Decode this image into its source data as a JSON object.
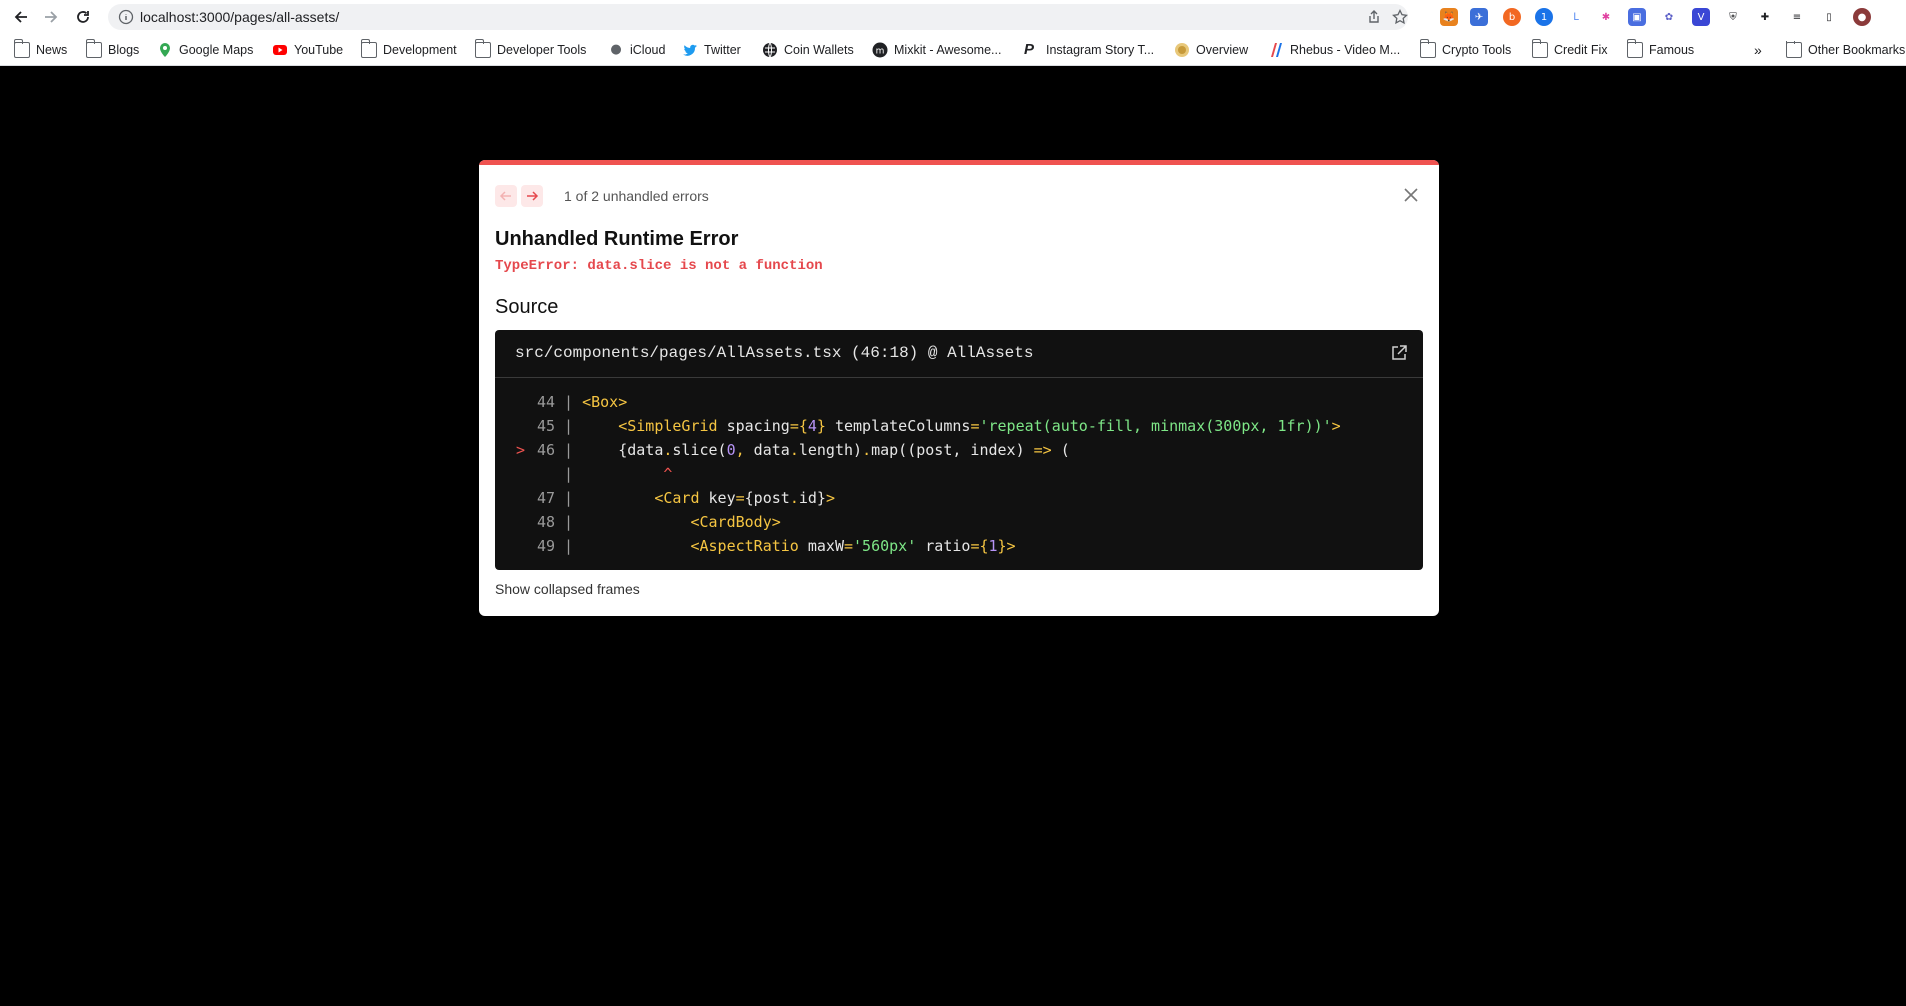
{
  "browser": {
    "url": "localhost:3000/pages/all-assets/",
    "bookmarks": [
      "News",
      "Blogs",
      "Google Maps",
      "YouTube",
      "Development",
      "Developer Tools",
      "iCloud",
      "Twitter",
      "Coin Wallets",
      "Mixkit - Awesome...",
      "Instagram Story T...",
      "Overview",
      "Rhebus - Video M...",
      "Crypto Tools",
      "Credit Fix",
      "Famous"
    ],
    "more_bookmarks": "»",
    "other_bookmarks": "Other Bookmarks"
  },
  "dialog": {
    "pager_text": "1 of 2 unhandled errors",
    "title": "Unhandled Runtime Error",
    "message": "TypeError: data.slice is not a function",
    "source_heading": "Source",
    "file_ref": "src/components/pages/AllAssets.tsx (46:18) @ AllAssets",
    "collapsed_link": "Show collapsed frames",
    "code_lines": [
      {
        "marker": " ",
        "num": "44",
        "tokens": [
          [
            "tag",
            "<Box>"
          ]
        ]
      },
      {
        "marker": " ",
        "num": "45",
        "tokens": [
          [
            "plain",
            "    "
          ],
          [
            "tag",
            "<SimpleGrid"
          ],
          [
            "attr",
            " spacing"
          ],
          [
            "tag",
            "={"
          ],
          [
            "numv",
            "4"
          ],
          [
            "tag",
            "}"
          ],
          [
            "attr",
            " templateColumns"
          ],
          [
            "tag",
            "="
          ],
          [
            "str",
            "'repeat(auto-fill, minmax(300px, 1fr))'"
          ],
          [
            "tag",
            ">"
          ]
        ]
      },
      {
        "marker": ">",
        "num": "46",
        "tokens": [
          [
            "plain",
            "    {data"
          ],
          [
            "tag",
            "."
          ],
          [
            "plain",
            "slice("
          ],
          [
            "numv",
            "0"
          ],
          [
            "tag",
            ","
          ],
          [
            "plain",
            " data"
          ],
          [
            "tag",
            "."
          ],
          [
            "plain",
            "length)"
          ],
          [
            "tag",
            "."
          ],
          [
            "plain",
            "map((post, index) "
          ],
          [
            "tag",
            "=>"
          ],
          [
            "plain",
            " ("
          ]
        ]
      },
      {
        "marker": " ",
        "num": "",
        "tokens": [
          [
            "plain",
            "         "
          ],
          [
            "caret",
            "^"
          ]
        ]
      },
      {
        "marker": " ",
        "num": "47",
        "tokens": [
          [
            "plain",
            "        "
          ],
          [
            "tag",
            "<Card"
          ],
          [
            "attr",
            " key"
          ],
          [
            "tag",
            "="
          ],
          [
            "plain",
            "{post"
          ],
          [
            "tag",
            "."
          ],
          [
            "plain",
            "id}"
          ],
          [
            "tag",
            ">"
          ]
        ]
      },
      {
        "marker": " ",
        "num": "48",
        "tokens": [
          [
            "plain",
            "            "
          ],
          [
            "tag",
            "<CardBody>"
          ]
        ]
      },
      {
        "marker": " ",
        "num": "49",
        "tokens": [
          [
            "plain",
            "            "
          ],
          [
            "tag",
            "<AspectRatio"
          ],
          [
            "attr",
            " maxW"
          ],
          [
            "tag",
            "="
          ],
          [
            "str",
            "'560px'"
          ],
          [
            "attr",
            " ratio"
          ],
          [
            "tag",
            "={"
          ],
          [
            "numv",
            "1"
          ],
          [
            "tag",
            "}>"
          ]
        ]
      }
    ]
  }
}
